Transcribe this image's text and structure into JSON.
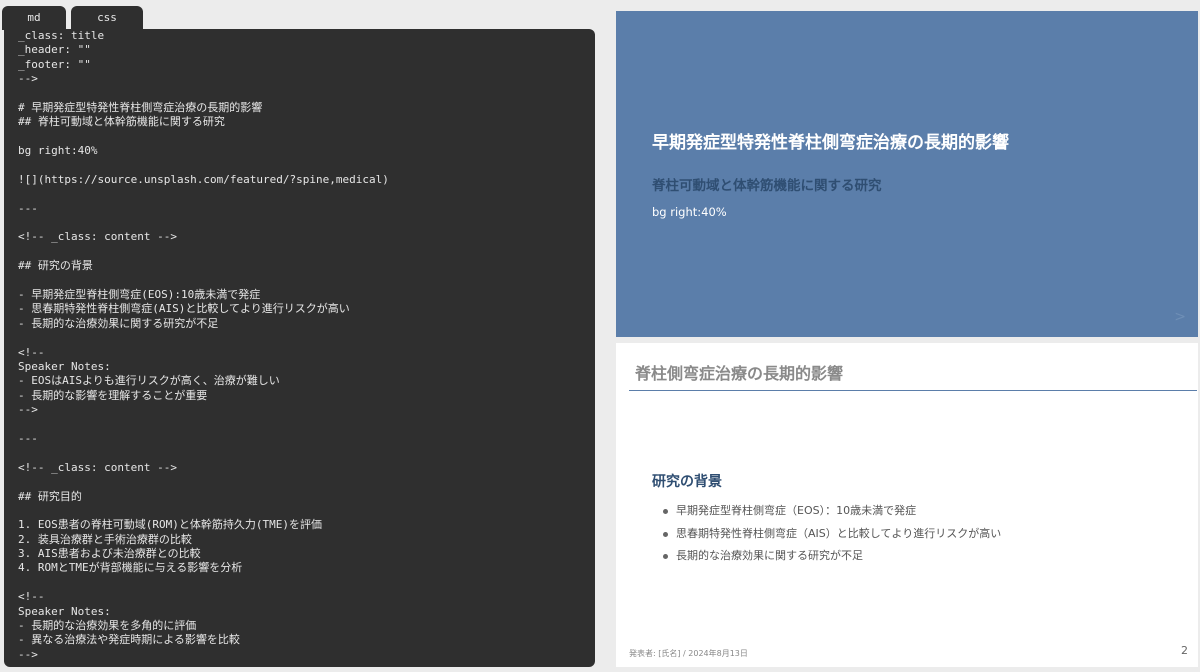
{
  "tabs": [
    {
      "label": "md"
    },
    {
      "label": "css"
    }
  ],
  "editor": {
    "lines": [
      "_class: title",
      "_header: \"\"",
      "_footer: \"\"",
      "-->",
      "",
      "# 早期発症型特発性脊柱側弯症治療の長期的影響",
      "## 脊柱可動域と体幹筋機能に関する研究",
      "",
      "bg right:40%",
      "",
      "![](https://source.unsplash.com/featured/?spine,medical)",
      "",
      "---",
      "",
      "<!-- _class: content -->",
      "",
      "## 研究の背景",
      "",
      "- 早期発症型脊柱側弯症(EOS):10歳未満で発症",
      "- 思春期特発性脊柱側弯症(AIS)と比較してより進行リスクが高い",
      "- 長期的な治療効果に関する研究が不足",
      "",
      "<!--",
      "Speaker Notes:",
      "- EOSはAISよりも進行リスクが高く、治療が難しい",
      "- 長期的な影響を理解することが重要",
      "-->",
      "",
      "---",
      "",
      "<!-- _class: content -->",
      "",
      "## 研究目的",
      "",
      "1. EOS患者の脊柱可動域(ROM)と体幹筋持久力(TME)を評価",
      "2. 装具治療群と手術治療群の比較",
      "3. AIS患者および未治療群との比較",
      "4. ROMとTMEが背部機能に与える影響を分析",
      "",
      "<!--",
      "Speaker Notes:",
      "- 長期的な治療効果を多角的に評価",
      "- 異なる治療法や発症時期による影響を比較",
      "-->"
    ]
  },
  "slide1": {
    "title": "早期発症型特発性脊柱側弯症治療の長期的影響",
    "subtitle": "脊柱可動域と体幹筋機能に関する研究",
    "bg_text": "bg right:40%",
    "next_glyph": ">"
  },
  "slide2": {
    "header": "脊柱側弯症治療の長期的影響",
    "heading": "研究の背景",
    "bullets": [
      "早期発症型脊柱側弯症（EOS）：10歳未満で発症",
      "思春期特発性脊柱側弯症（AIS）と比較してより進行リスクが高い",
      "長期的な治療効果に関する研究が不足"
    ],
    "footer": "発表者: [氏名] / 2024年8月13日",
    "page": "2"
  },
  "colors": {
    "editor_bg": "#2f2f2f",
    "slide1_bg": "#5b7eaa",
    "accent_dark": "#2f4e72"
  }
}
